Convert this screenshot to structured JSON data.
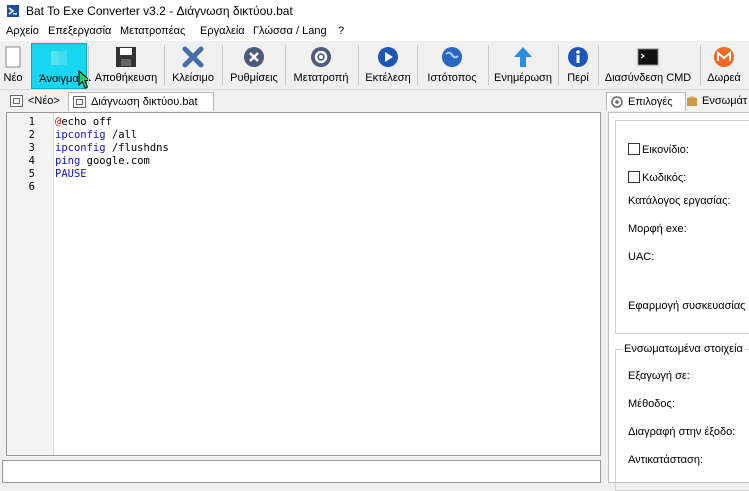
{
  "window": {
    "title": "Bat To Exe Converter v3.2 - Διάγνωση δικτύου.bat"
  },
  "menu": [
    "Αρχείο",
    "Επεξεργασία",
    "Μετατροπέας",
    "Εργαλεία",
    "Γλώσσα / Lang",
    "?"
  ],
  "toolbar": [
    {
      "label": "Νέο",
      "icon": "new-icon"
    },
    {
      "label": "Άνοιγμα",
      "icon": "open-icon",
      "active": true
    },
    {
      "label": "Αποθήκευση",
      "icon": "save-icon"
    },
    {
      "label": "Κλείσιμο",
      "icon": "close-icon"
    },
    {
      "label": "Ρυθμίσεις",
      "icon": "settings-icon"
    },
    {
      "label": "Μετατροπή",
      "icon": "gear-icon"
    },
    {
      "label": "Εκτέλεση",
      "icon": "play-icon"
    },
    {
      "label": "Ιστότοπος",
      "icon": "globe-icon"
    },
    {
      "label": "Ενημέρωση",
      "icon": "up-arrow-icon"
    },
    {
      "label": "Περί",
      "icon": "info-icon"
    },
    {
      "label": "Διασύνδεση CMD",
      "icon": "cmd-icon"
    },
    {
      "label": "Δωρεά",
      "icon": "donate-icon"
    }
  ],
  "tabs": {
    "new": "<Νέο>",
    "file": "Διάγνωση δικτύου.bat"
  },
  "editor": {
    "lines": [
      {
        "n": "1",
        "a": "@",
        "b": "echo off",
        "kw": ""
      },
      {
        "n": "2",
        "a": "",
        "b": " /all",
        "kw": "ipconfig"
      },
      {
        "n": "3",
        "a": "",
        "b": " /flushdns",
        "kw": "ipconfig"
      },
      {
        "n": "4",
        "a": "",
        "b": " google.com",
        "kw": "ping"
      },
      {
        "n": "5",
        "a": "",
        "b": "",
        "kw": "PAUSE"
      },
      {
        "n": "6",
        "a": "",
        "b": "",
        "kw": ""
      }
    ]
  },
  "right": {
    "tab_options": "Επιλογές",
    "tab_embed": "Ενσωμάτ",
    "icon_label": "Εικονίδιο:",
    "password_label": "Κωδικός:",
    "workdir_label": "Κατάλογος εργασίας:",
    "exe_format_label": "Μορφή exe:",
    "uac_label": "UAC:",
    "app_label": "Εφαρμογή συσκευασίας",
    "embedded_group": "Ενσωματωμένα στοιχεία",
    "extract_label": "Εξαγωγή σε:",
    "method_label": "Μέθοδος:",
    "delete_label": "Διαγραφή στην έξοδο:",
    "replace_label": "Αντικατάσταση:"
  },
  "colors": {
    "active_button": "#17d6f0",
    "keyword": "#1111cc"
  }
}
